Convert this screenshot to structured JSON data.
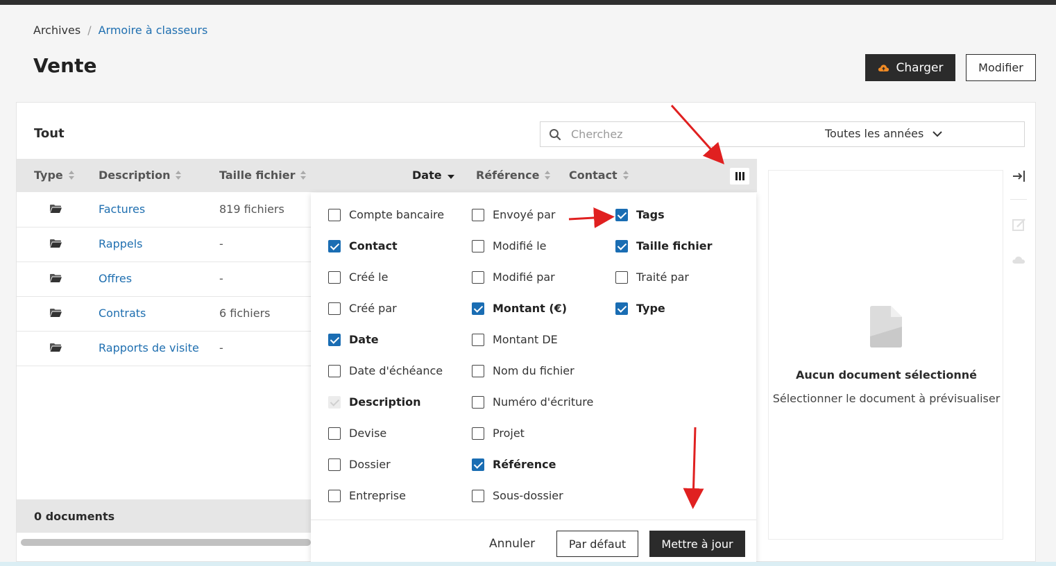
{
  "breadcrumb": {
    "root": "Archives",
    "separator": "/",
    "current": "Armoire à classeurs"
  },
  "page": {
    "title": "Vente"
  },
  "header_buttons": {
    "charger": "Charger",
    "modifier": "Modifier"
  },
  "list": {
    "title": "Tout",
    "search_placeholder": "Cherchez",
    "year_filter": "Toutes les années",
    "columns": {
      "type": "Type",
      "description": "Description",
      "taille": "Taille fichier",
      "date": "Date",
      "reference": "Référence",
      "contact": "Contact"
    },
    "rows": [
      {
        "name": "Factures",
        "size": "819 fichiers"
      },
      {
        "name": "Rappels",
        "size": "-"
      },
      {
        "name": "Offres",
        "size": "-"
      },
      {
        "name": "Contrats",
        "size": "6 fichiers"
      },
      {
        "name": "Rapports de visite",
        "size": "-"
      }
    ],
    "footer": "0 documents"
  },
  "column_picker": {
    "options": [
      {
        "label": "Compte bancaire",
        "checked": false
      },
      {
        "label": "Contact",
        "checked": true
      },
      {
        "label": "Créé le",
        "checked": false
      },
      {
        "label": "Créé par",
        "checked": false
      },
      {
        "label": "Date",
        "checked": true
      },
      {
        "label": "Date d'échéance",
        "checked": false
      },
      {
        "label": "Description",
        "checked": true,
        "disabled": true
      },
      {
        "label": "Devise",
        "checked": false
      },
      {
        "label": "Dossier",
        "checked": false
      },
      {
        "label": "Entreprise",
        "checked": false
      },
      {
        "label": "Envoyé par",
        "checked": false
      },
      {
        "label": "Modifié le",
        "checked": false
      },
      {
        "label": "Modifié par",
        "checked": false
      },
      {
        "label": "Montant (€)",
        "checked": true
      },
      {
        "label": "Montant DE",
        "checked": false
      },
      {
        "label": "Nom du fichier",
        "checked": false
      },
      {
        "label": "Numéro d'écriture",
        "checked": false
      },
      {
        "label": "Projet",
        "checked": false
      },
      {
        "label": "Référence",
        "checked": true
      },
      {
        "label": "Sous-dossier",
        "checked": false
      },
      {
        "label": "Tags",
        "checked": true
      },
      {
        "label": "Taille fichier",
        "checked": true
      },
      {
        "label": "Traité par",
        "checked": false
      },
      {
        "label": "Type",
        "checked": true
      }
    ],
    "buttons": {
      "cancel": "Annuler",
      "default": "Par défaut",
      "update": "Mettre à jour"
    }
  },
  "preview": {
    "title": "Aucun document sélectionné",
    "subtitle": "Sélectionner le document à prévisualiser"
  },
  "colors": {
    "accent": "#1a6db3",
    "link": "#1f6fb0",
    "dark": "#2b2b2b",
    "annotation": "#e02020",
    "upload_icon": "#f08a24"
  },
  "icons": [
    "search-icon",
    "chevron-down-icon",
    "sort-icon",
    "columns-icon",
    "folder-icon",
    "cloud-upload-icon",
    "document-icon",
    "collapse-panel-icon",
    "edit-icon",
    "download-icon"
  ]
}
